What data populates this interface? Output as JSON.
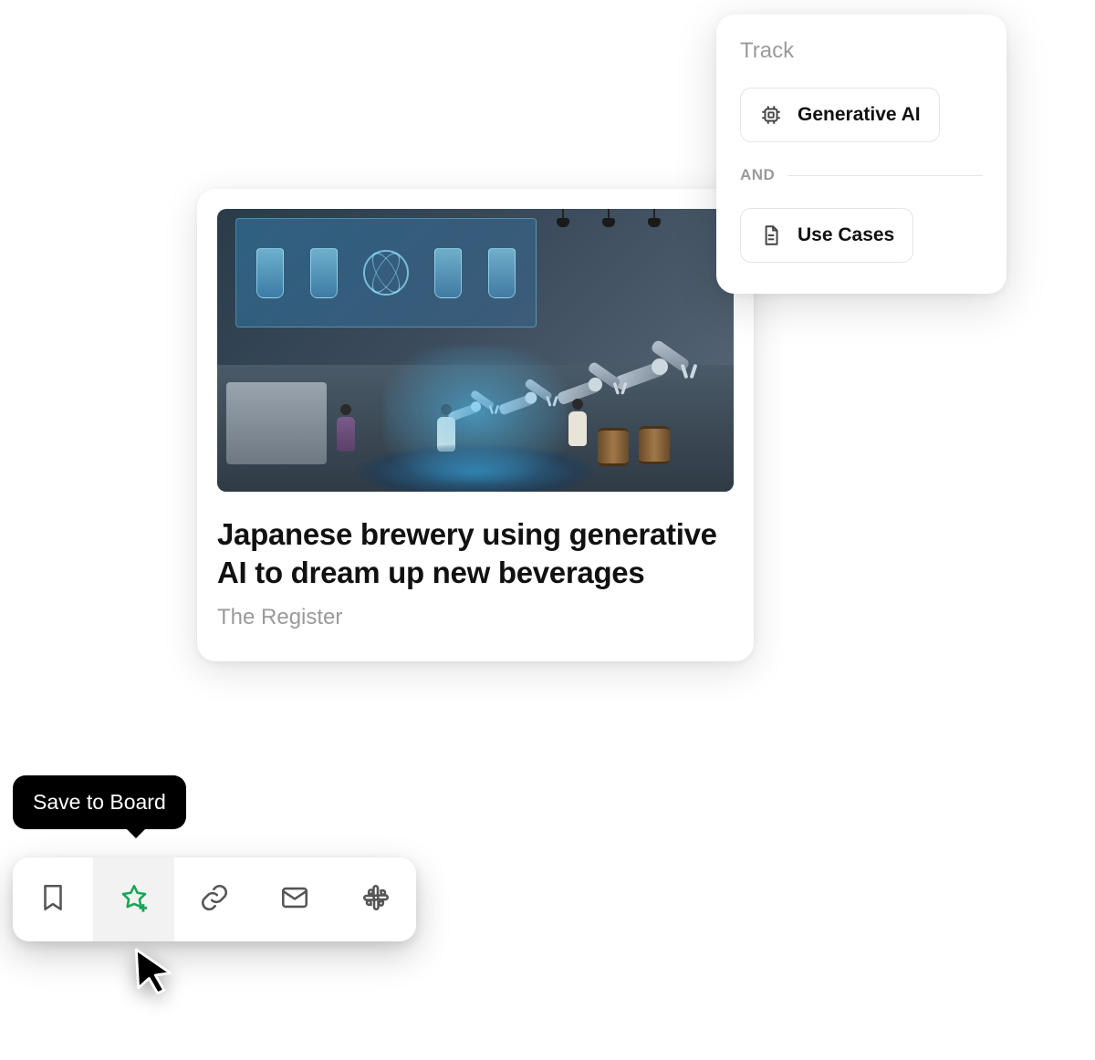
{
  "article": {
    "title": "Japanese brewery using generative AI to dream up new beverages",
    "source": "The Register"
  },
  "track": {
    "heading": "Track",
    "and_label": "AND",
    "filters": [
      {
        "icon": "cpu-icon",
        "label": "Generative AI"
      },
      {
        "icon": "document-icon",
        "label": "Use Cases"
      }
    ]
  },
  "tooltip": {
    "text": "Save to Board"
  },
  "toolbar": {
    "items": [
      {
        "name": "bookmark-button",
        "icon": "bookmark-icon"
      },
      {
        "name": "save-to-board-button",
        "icon": "star-plus-icon",
        "active": true
      },
      {
        "name": "copy-link-button",
        "icon": "link-icon"
      },
      {
        "name": "email-button",
        "icon": "mail-icon"
      },
      {
        "name": "share-slack-button",
        "icon": "slack-icon"
      }
    ]
  }
}
